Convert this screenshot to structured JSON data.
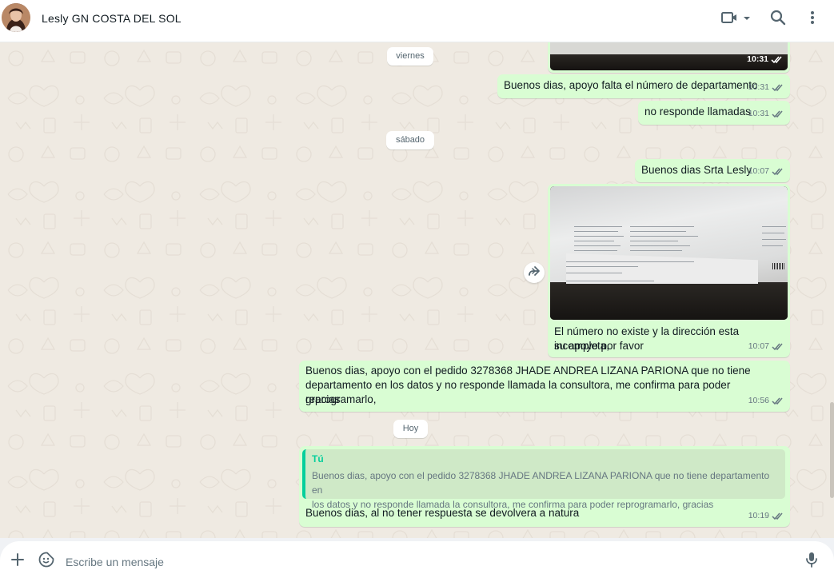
{
  "header": {
    "contact_name": "Lesly GN COSTA DEL SOL",
    "icons": [
      "video-call-icon",
      "chevron-down-icon",
      "search-icon",
      "menu-dots-icon"
    ]
  },
  "chat": {
    "date_chips": [
      "viernes",
      "sábado",
      "Hoy"
    ],
    "messages": [
      {
        "type": "image",
        "time": "10:31",
        "status": "read"
      },
      {
        "type": "text",
        "text": "Buenos dias, apoyo falta el número de departamento",
        "time": "10:31",
        "status": "read"
      },
      {
        "type": "text",
        "text": "no responde llamadas",
        "time": "10:31",
        "status": "read"
      },
      {
        "type": "text",
        "text": "Buenos dias Srta Lesly",
        "time": "10:07",
        "status": "read"
      },
      {
        "type": "image_caption",
        "caption_line1": "El número no existe y la dirección esta incompleta,",
        "caption_line2": "su apoyo por favor",
        "time": "10:07",
        "status": "read"
      },
      {
        "type": "text",
        "line1": "Buenos dias, apoyo con el pedido 3278368 JHADE ANDREA LIZANA PARIONA que no tiene",
        "line2": "departamento en los datos y no responde llamada la consultora, me confirma para poder reprogramarlo,",
        "line3": "gracias",
        "time": "10:56",
        "status": "read"
      },
      {
        "type": "reply",
        "quoted_author": "Tú",
        "quoted_line1": "Buenos dias, apoyo con el pedido 3278368 JHADE ANDREA LIZANA PARIONA que no tiene departamento en",
        "quoted_line2": "los datos y no responde llamada la consultora, me confirma para poder reprogramarlo, gracias",
        "text": "Buenos dias, al no tener respuesta se devolvera a natura",
        "time": "10:19",
        "status": "read"
      }
    ]
  },
  "composer": {
    "placeholder": "Escribe un mensaje",
    "icons": [
      "plus-icon",
      "sticker-icon",
      "microphone-icon"
    ]
  },
  "colors": {
    "bubble_out": "#d9fdd3",
    "chat_bg": "#efeae2",
    "read_check": "#53bdeb",
    "accent": "#06cf9c"
  }
}
